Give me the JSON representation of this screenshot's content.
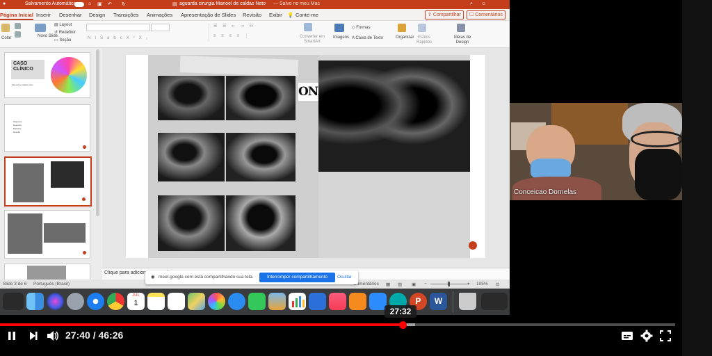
{
  "window": {
    "autosave_label": "Salvamento Automático",
    "autosave_state": "off",
    "file_title": "aguarda cirurgia Manoel de caldas Neto",
    "save_status": "Salvo no meu Mac"
  },
  "ribbon_tabs": [
    "Página Inicial",
    "Inserir",
    "Desenhar",
    "Design",
    "Transições",
    "Animações",
    "Apresentação de Slides",
    "Revisão",
    "Exibir"
  ],
  "tell_me": "Conte-me",
  "share_label": "Compartilhar",
  "comments_label": "Comentários",
  "ribbon": {
    "paste": "Colar",
    "new_slide": "Novo Slide",
    "layout": "Layout",
    "reset": "Redefinir",
    "section": "Seção",
    "smartart": "Converter em SmartArt",
    "images": "Imagens",
    "shapes": "Formas",
    "textbox": "Caixa de Texto",
    "arrange": "Organizar",
    "quick_styles": "Estilos Rápidos",
    "design_ideas": "Ideias de Design",
    "font_buttons": [
      "N",
      "I",
      "S",
      "abc",
      "X²",
      "X₂"
    ]
  },
  "thumbnails": [
    {
      "title": "CASO CLÍNICO",
      "subtitle": "Manoel de caldas Neto"
    },
    {
      "bullets": [
        "Objetivos",
        "Desenho",
        "Métodos",
        "Results"
      ]
    },
    {
      "selected": true
    },
    {},
    {}
  ],
  "slide": {
    "partial_text": "ONA"
  },
  "notes_placeholder": "Clique para adicionar anotações",
  "status": {
    "slide_counter": "Slide 3 de 6",
    "language": "Português (Brasil)",
    "comments": "Comentários",
    "zoom": "105%"
  },
  "share_banner": {
    "message": "meet.google.com está compartilhando sua tela.",
    "stop_label": "Interromper compartilhamento",
    "hide_label": "Ocultar"
  },
  "dock_apps": [
    "finder-icon",
    "siri-icon",
    "launchpad-icon",
    "safari-icon",
    "chrome-icon",
    "calendar-icon",
    "notes-icon",
    "reminders-icon",
    "maps-icon",
    "photos-icon",
    "messages-icon",
    "facetime-icon",
    "preview-icon",
    "numbers-icon",
    "keynote-icon",
    "music-icon",
    "books-icon",
    "zoom-icon",
    "meet-icon",
    "powerpoint-icon",
    "word-icon",
    "trash-icon"
  ],
  "dock_calendar": {
    "month": "JUL",
    "day": "1"
  },
  "participant": {
    "name": "Conceicao Dornelas"
  },
  "player": {
    "current_time": "27:40",
    "duration": "46:26",
    "hover_time": "27:32",
    "progress": 0.596
  },
  "colors": {
    "accent": "#c43e1c",
    "player_red": "#ff0000",
    "meet_blue": "#1a73e8"
  }
}
